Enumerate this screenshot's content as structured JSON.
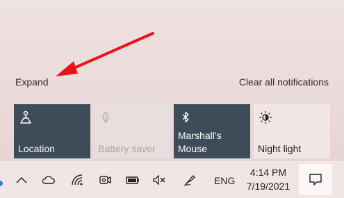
{
  "action_center": {
    "expand_label": "Expand",
    "clear_all_label": "Clear all notifications",
    "tiles": [
      {
        "label": "Location",
        "icon": "location-icon",
        "state": "on"
      },
      {
        "label": "Battery saver",
        "icon": "battery-saver-icon",
        "state": "disabled"
      },
      {
        "label": "Marshall's\nMouse",
        "icon": "bluetooth-icon",
        "state": "on"
      },
      {
        "label": "Night light",
        "icon": "night-light-icon",
        "state": "off"
      }
    ],
    "colors": {
      "tile_on": "#3d4c58",
      "annotation_arrow": "#e8141b"
    }
  },
  "taskbar": {
    "icons": [
      "chevron-up-icon",
      "cloud-icon",
      "wifi-icon",
      "meet-now-icon",
      "battery-icon",
      "volume-muted-icon",
      "pen-icon"
    ],
    "language": "ENG",
    "time": "4:14 PM",
    "date": "7/19/2021",
    "notification_icon": "notification-center-icon"
  }
}
